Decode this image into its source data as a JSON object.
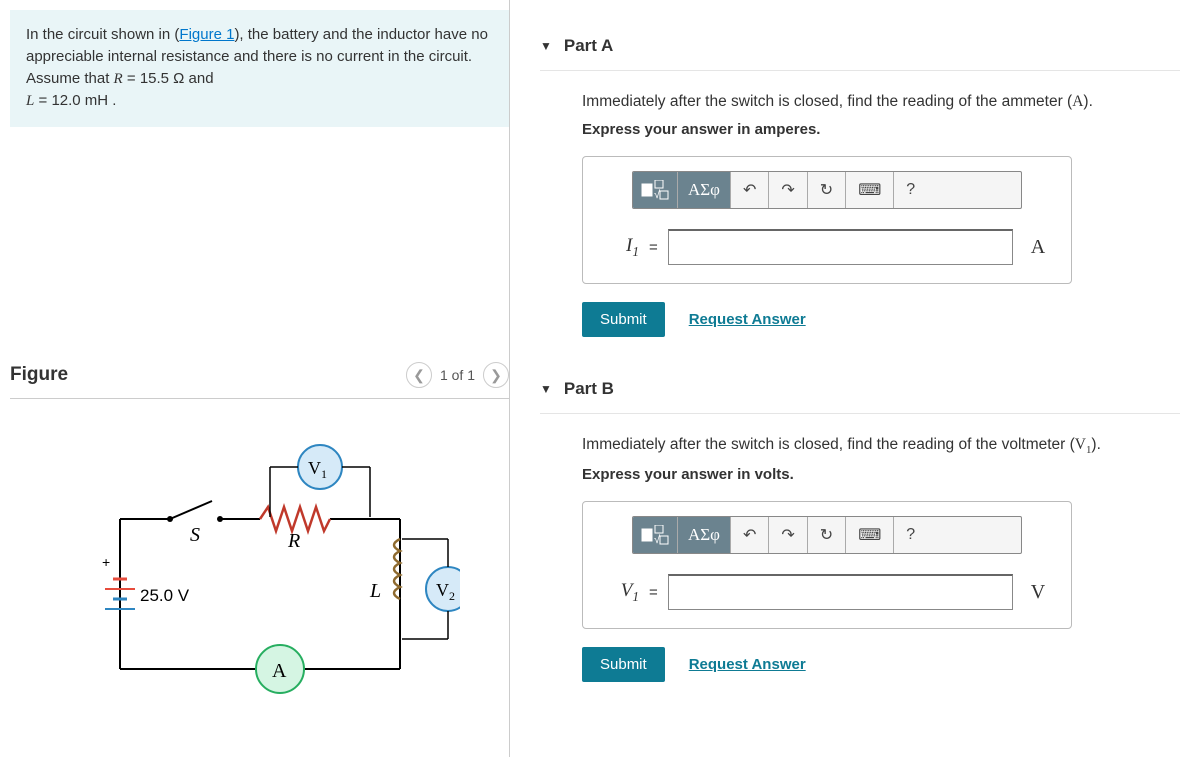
{
  "problem": {
    "intro_prefix": "In the circuit shown in (",
    "figure_link": "Figure 1",
    "intro_suffix": "), the battery and the inductor have no appreciable internal resistance and there is no current in the circuit. Assume that ",
    "R_var": "R",
    "R_eq": " = 15.5 Ω and ",
    "L_var": "L",
    "L_eq": " = 12.0 mH ."
  },
  "figure": {
    "title": "Figure",
    "nav": "1 of 1",
    "voltage": "25.0 V",
    "V1": "V₁",
    "V2": "V₂",
    "S": "S",
    "R": "R",
    "L": "L",
    "A": "A",
    "plus": "+"
  },
  "partA": {
    "title": "Part A",
    "question_pre": "Immediately after the switch is closed, find the reading of the ammeter (",
    "question_sym": "A",
    "question_post": ").",
    "instruct": "Express your answer in amperes.",
    "var": "I₁",
    "eq": "=",
    "unit": "A"
  },
  "partB": {
    "title": "Part B",
    "question_pre": "Immediately after the switch is closed, find the reading of the voltmeter (",
    "question_sym": "V₁",
    "question_post": ").",
    "instruct": "Express your answer in volts.",
    "var": "V₁",
    "eq": "=",
    "unit": "V"
  },
  "toolbar": {
    "greek": "ΑΣφ",
    "undo": "↶",
    "redo": "↷",
    "reset": "↻",
    "keyboard": "⌨",
    "help": "?"
  },
  "actions": {
    "submit": "Submit",
    "request": "Request Answer"
  }
}
